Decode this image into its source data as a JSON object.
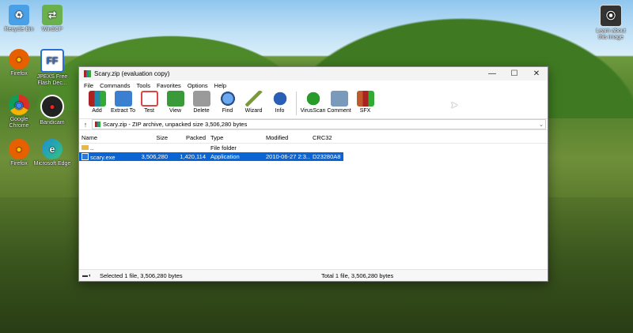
{
  "desktop": {
    "icons": [
      {
        "label": "Recycle Bin",
        "icon": "recycle-bin-icon",
        "color": "#4aa0e6",
        "glyph": "♻"
      },
      {
        "label": "WinSCP",
        "icon": "winscp-icon",
        "color": "#6ab04c",
        "glyph": "⇄"
      },
      {
        "label": "Firefox",
        "icon": "firefox-icon",
        "color": "#e66000",
        "glyph": "●"
      },
      {
        "label": "JPEXS Free Flash Dec...",
        "icon": "jpexs-icon",
        "color": "#2a6fd6",
        "glyph": "FF"
      },
      {
        "label": "Google Chrome",
        "icon": "chrome-icon",
        "color": "#d93025",
        "glyph": "◉"
      },
      {
        "label": "Bandicam",
        "icon": "bandicam-icon",
        "color": "#222222",
        "glyph": "●"
      },
      {
        "label": "Firefox",
        "icon": "firefox-icon",
        "color": "#e66000",
        "glyph": "●"
      },
      {
        "label": "Microsoft Edge",
        "icon": "edge-icon",
        "color": "#1a8fd8",
        "glyph": "e"
      }
    ],
    "learn_label": "Learn about this image"
  },
  "window": {
    "title": "Scary.zip (evaluation copy)",
    "menu": [
      "File",
      "Commands",
      "Tools",
      "Favorites",
      "Options",
      "Help"
    ],
    "toolbar": [
      {
        "label": "Add",
        "color": "#b03a8a"
      },
      {
        "label": "Extract To",
        "color": "#3a7fd0"
      },
      {
        "label": "Test",
        "color": "#d44"
      },
      {
        "label": "View",
        "color": "#3a9a3a"
      },
      {
        "label": "Delete",
        "color": "#888888"
      },
      {
        "label": "Find",
        "color": "#2a6fd6"
      },
      {
        "label": "Wizard",
        "color": "#7a9a3a"
      },
      {
        "label": "Info",
        "color": "#2a5fb6"
      },
      {
        "label": "VirusScan",
        "color": "#2a9a2a"
      },
      {
        "label": "Comment",
        "color": "#5a7a9a"
      },
      {
        "label": "SFX",
        "color": "#c05a2a"
      }
    ],
    "address": "Scary.zip - ZIP archive, unpacked size 3,506,280 bytes",
    "columns": [
      "Name",
      "Size",
      "Packed",
      "Type",
      "Modified",
      "CRC32"
    ],
    "rows": [
      {
        "name": "..",
        "size": "",
        "packed": "",
        "type": "File folder",
        "modified": "",
        "crc": ""
      },
      {
        "name": "scary.exe",
        "size": "3,506,280",
        "packed": "1,420,114",
        "type": "Application",
        "modified": "2010-06-27 2:3...",
        "crc": "D23280A8"
      }
    ],
    "status_left": "Selected 1 file, 3,506,280 bytes",
    "status_right": "Total 1 file, 3,506,280 bytes"
  }
}
